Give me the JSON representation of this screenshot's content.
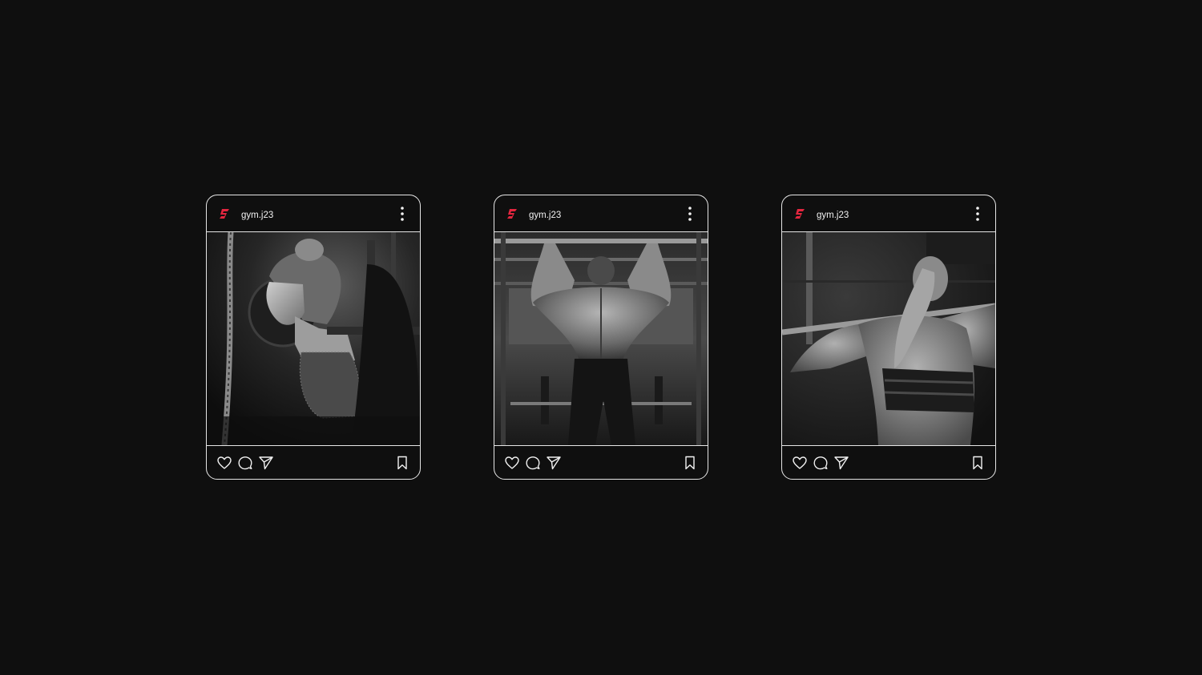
{
  "posts": [
    {
      "username": "gym.j23",
      "photo": "woman-squat-barbell"
    },
    {
      "username": "gym.j23",
      "photo": "man-pull-up-back"
    },
    {
      "username": "gym.j23",
      "photo": "woman-barbell-back"
    }
  ],
  "icons": {
    "logo": "brand-logo-icon",
    "more": "more-vertical-icon",
    "like": "heart-icon",
    "comment": "comment-icon",
    "share": "send-icon",
    "save": "bookmark-icon"
  },
  "colors": {
    "background": "#0f0f0f",
    "border": "#e6e6e6",
    "brand": "#e3263f"
  }
}
